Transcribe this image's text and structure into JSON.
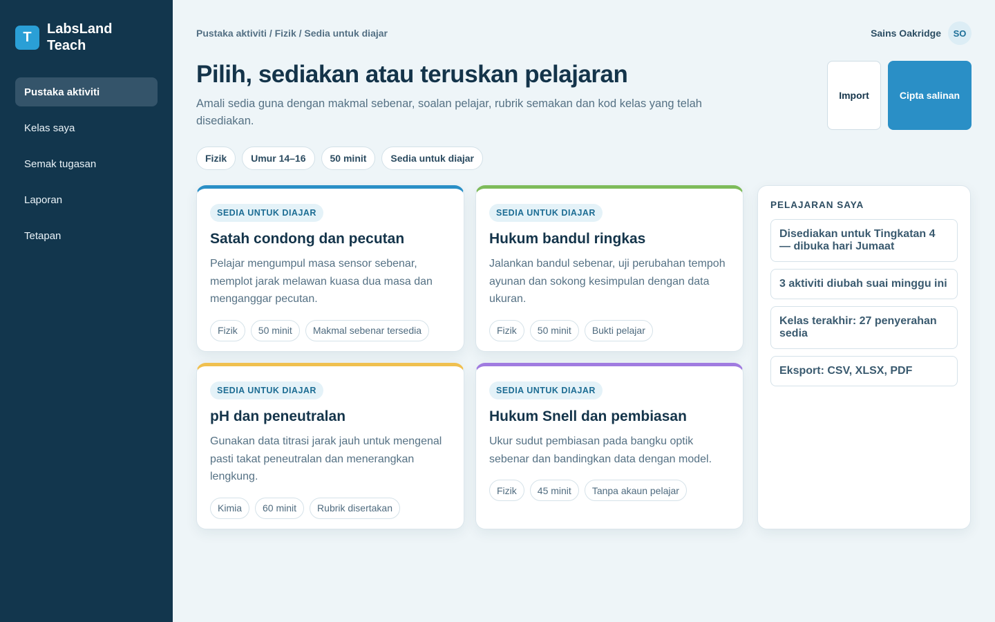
{
  "brand": {
    "logo_letter": "T",
    "name_line1": "LabsLand",
    "name_line2": "Teach"
  },
  "nav": [
    {
      "label": "Pustaka aktiviti",
      "active": true
    },
    {
      "label": "Kelas saya"
    },
    {
      "label": "Semak tugasan"
    },
    {
      "label": "Laporan"
    },
    {
      "label": "Tetapan"
    }
  ],
  "breadcrumb": "Pustaka aktiviti / Fizik / Sedia untuk diajar",
  "user": {
    "name": "Sains Oakridge",
    "initials": "SO"
  },
  "header": {
    "title": "Pilih, sediakan atau teruskan pelajaran",
    "subtitle": "Amali sedia guna dengan makmal sebenar, soalan pelajar, rubrik semakan dan kod kelas yang telah disediakan.",
    "import_label": "Import",
    "primary_label": "Cipta salinan"
  },
  "filters": [
    "Fizik",
    "Umur 14–16",
    "50 minit",
    "Sedia untuk diajar"
  ],
  "cards": [
    {
      "badge": "SEDIA UNTUK DIAJAR",
      "title": "Satah condong dan pecutan",
      "desc": "Pelajar mengumpul masa sensor sebenar, memplot jarak melawan kuasa dua masa dan menganggar pecutan.",
      "tags": [
        "Fizik",
        "50 minit",
        "Makmal sebenar tersedia"
      ],
      "accent": "#2a8fc6"
    },
    {
      "badge": "SEDIA UNTUK DIAJAR",
      "title": "Hukum bandul ringkas",
      "desc": "Jalankan bandul sebenar, uji perubahan tempoh ayunan dan sokong kesimpulan dengan data ukuran.",
      "tags": [
        "Fizik",
        "50 minit",
        "Bukti pelajar"
      ],
      "accent": "#7dbb5a"
    },
    {
      "badge": "SEDIA UNTUK DIAJAR",
      "title": "pH dan peneutralan",
      "desc": "Gunakan data titrasi jarak jauh untuk mengenal pasti takat peneutralan dan menerangkan lengkung.",
      "tags": [
        "Kimia",
        "60 minit",
        "Rubrik disertakan"
      ],
      "accent": "#f0c04f"
    },
    {
      "badge": "SEDIA UNTUK DIAJAR",
      "title": "Hukum Snell dan pembiasan",
      "desc": "Ukur sudut pembiasan pada bangku optik sebenar dan bandingkan data dengan model.",
      "tags": [
        "Fizik",
        "45 minit",
        "Tanpa akaun pelajar"
      ],
      "accent": "#a07be0"
    }
  ],
  "panel": {
    "title": "PELAJARAN SAYA",
    "items": [
      "Disediakan untuk Tingkatan 4 — dibuka hari Jumaat",
      "3 aktiviti diubah suai minggu ini",
      "Kelas terakhir: 27 penyerahan sedia",
      "Eksport: CSV, XLSX, PDF"
    ]
  }
}
